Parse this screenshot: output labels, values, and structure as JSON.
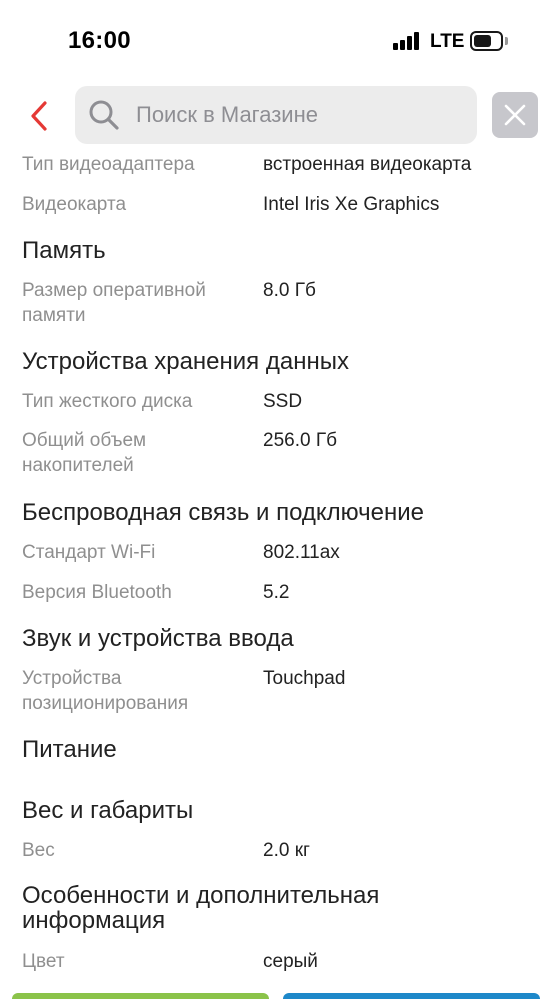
{
  "status_bar": {
    "time": "16:00",
    "network": "LTE"
  },
  "header": {
    "search_placeholder": "Поиск в Магазине"
  },
  "colors": {
    "accent_red": "#e53935",
    "green_button": "#8bc34a",
    "blue_button": "#1e88c9"
  },
  "specs": {
    "r0": {
      "label": "Тип видеоадаптера",
      "value": "встроенная видеокарта"
    },
    "r1": {
      "label": "Видеокарта",
      "value": "Intel Iris Xe Graphics"
    },
    "s_memory": "Память",
    "r2": {
      "label": "Размер оперативной памяти",
      "value": "8.0 Гб"
    },
    "s_storage": "Устройства хранения данных",
    "r3": {
      "label": "Тип жесткого диска",
      "value": "SSD"
    },
    "r4": {
      "label": "Общий объем накопителей",
      "value": "256.0 Гб"
    },
    "s_wireless": "Беспроводная связь и подключение",
    "r5": {
      "label": "Стандарт Wi-Fi",
      "value": "802.11ax"
    },
    "r6": {
      "label": "Версия Bluetooth",
      "value": "5.2"
    },
    "s_sound": "Звук и устройства ввода",
    "r7": {
      "label": "Устройства позиционирования",
      "value": "Touchpad"
    },
    "s_power": "Питание",
    "s_weight": "Вес и габариты",
    "r8": {
      "label": "Вес",
      "value": "2.0 кг"
    },
    "s_extra": "Особенности и дополнительная информация",
    "r9": {
      "label": "Цвет",
      "value": "серый"
    }
  }
}
